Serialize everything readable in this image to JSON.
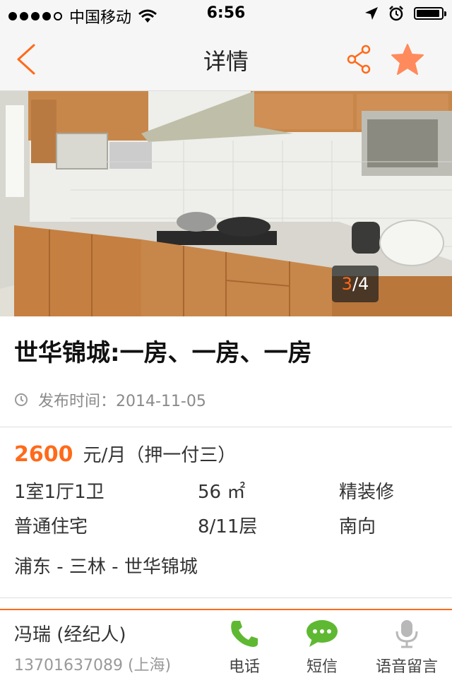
{
  "status_bar": {
    "carrier": "中国移动",
    "time": "6:56",
    "signal_dots_filled": 4,
    "signal_dots_total": 5
  },
  "nav": {
    "title": "详情",
    "back_icon": "chevron-left-icon",
    "share_icon": "share-icon",
    "favorite_icon": "star-icon",
    "accent_color": "#ff6a1a"
  },
  "gallery": {
    "current": "3",
    "separator": "/",
    "total": "4"
  },
  "listing": {
    "title": "世华锦城:一房、一房、一房",
    "publish_label": "发布时间：",
    "publish_date": "2014-11-05",
    "price": "2600",
    "price_unit": "元/月（押一付三）",
    "layout": "1室1厅1卫",
    "area": "56 ㎡",
    "decoration": "精装修",
    "property_type": "普通住宅",
    "floor": "8/11层",
    "orientation": "南向",
    "location": "浦东 - 三林 - 世华锦城"
  },
  "contact": {
    "agent_name": "冯瑞 (经纪人)",
    "agent_phone": "13701637089 (上海)",
    "call_label": "电话",
    "sms_label": "短信",
    "voice_label": "语音留言",
    "call_color": "#5fb832",
    "voice_color": "#b8b8b8"
  }
}
